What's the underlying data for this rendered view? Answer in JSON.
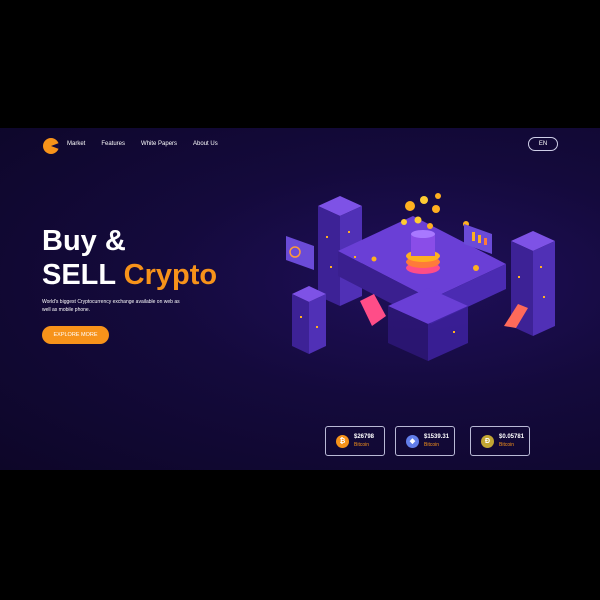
{
  "nav": {
    "items": [
      {
        "label": "Market"
      },
      {
        "label": "Features"
      },
      {
        "label": "White Papers"
      },
      {
        "label": "About Us"
      }
    ],
    "language": "EN"
  },
  "hero": {
    "title_line1": "Buy &",
    "title_line2_plain": "SELL ",
    "title_line2_accent": "Crypto",
    "subtitle": "World's biggest Cryptocurrency exchange available on web as well as mobile phone.",
    "cta_label": "EXPLORE MORE"
  },
  "tickers": [
    {
      "price": "$26798",
      "name": "Bitcoin",
      "symbol": "₿",
      "color": "#f7931a"
    },
    {
      "price": "$1539.31",
      "name": "Bitcoin",
      "symbol": "◆",
      "color": "#627eea"
    },
    {
      "price": "$0.05781",
      "name": "Bitcoin",
      "symbol": "Ð",
      "color": "#c2a633"
    }
  ],
  "colors": {
    "accent": "#f7931a",
    "background": "#140a3c",
    "platform": "#6a3fd6"
  }
}
